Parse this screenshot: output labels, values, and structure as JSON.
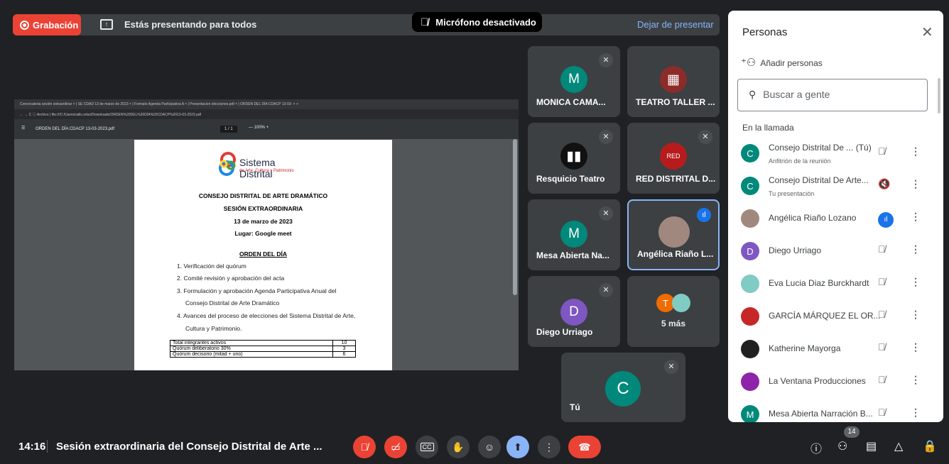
{
  "top": {
    "recording_label": "Grabación",
    "presenting_text": "Estás presentando para todos",
    "stop_presenting": "Dejar de presentar",
    "mic_toast": "Micrófono desactivado"
  },
  "shared_doc": {
    "tabs_text": "Convocatoria sesión extraordinar ×  |  SE CDAD 13 de marzo de 2023 ×  |  Formato Agenda Participativa A ×  |  Presentacion elecciones.pdf ×  |  ORDEN DEL DÍA CDACP 13-03- ×  +",
    "url_text": "←  →  C   ⓘ Archivo | file:///C:/Users/raiib.celso/Downloads/ORDEN%20DEL%20DÍA%20CDACP%2013-03-2023.pdf",
    "pdf_title": "ORDEN DEL DÍA CDACP 13-03-2023.pdf",
    "pdf_pages": "1 / 1",
    "pdf_zoom": "—  100%  +",
    "logo_line1": "Sistema Distrital",
    "logo_line2": "de Arte, Cultura y Patrimonio",
    "heading1": "CONSEJO DISTRITAL DE ARTE DRAMÁTICO",
    "heading2": "SESIÓN EXTRAORDINARIA",
    "heading3": "13 de marzo de 2023",
    "heading4": "Lugar: Google meet",
    "agenda_title": "ORDEN DEL DÍA",
    "items": [
      "1.  Verificación del quórum",
      "2.  Comité revisión y aprobación del acta",
      "3.  Formulación y aprobación Agenda Participativa Anual del",
      "Consejo Distrital de Arte Dramático",
      "4.  Avances del proceso de elecciones del Sistema Distrital de Arte,",
      "Cultura y Patrimonio."
    ],
    "table": [
      [
        "Total integrantes activos",
        "10"
      ],
      [
        "Quórum deliberatorio 30%",
        "3"
      ],
      [
        "Quórum decisorio (mitad + uno)",
        "6"
      ]
    ]
  },
  "tiles": [
    {
      "name": "MONICA CAMA...",
      "initial": "M",
      "color": "#00897b"
    },
    {
      "name": "TEATRO TALLER ...",
      "initial": "",
      "color": "#8d2b2b"
    },
    {
      "name": "Resquicio Teatro",
      "initial": "",
      "color": "#111111"
    },
    {
      "name": "RED DISTRITAL D...",
      "initial": "",
      "color": "#b71c1c"
    },
    {
      "name": "Mesa Abierta Na...",
      "initial": "M",
      "color": "#00897b"
    },
    {
      "name": "Angélica Riaño L...",
      "initial": "",
      "color": "#a1887f"
    },
    {
      "name": "Diego Urriago",
      "initial": "D",
      "color": "#7e57c2"
    },
    {
      "name": "5 más",
      "initial": "T",
      "color": "#ef6c00"
    },
    {
      "name": "Tú",
      "initial": "C",
      "color": "#00897b"
    }
  ],
  "people": {
    "title": "Personas",
    "add": "Añadir personas",
    "search_placeholder": "Buscar a gente",
    "section": "En la llamada",
    "rows": [
      {
        "name": "Consejo Distrital De ...  (Tú)",
        "sub": "Anfitrión de la reunión",
        "initial": "C",
        "color": "#00897b"
      },
      {
        "name": "Consejo Distrital De Arte...",
        "sub": "Tu presentación",
        "initial": "C",
        "color": "#00897b"
      },
      {
        "name": "Angélica Riaño Lozano",
        "sub": "",
        "initial": "",
        "color": "#a1887f"
      },
      {
        "name": "Diego Urriago",
        "sub": "",
        "initial": "D",
        "color": "#7e57c2"
      },
      {
        "name": "Eva Lucia Diaz Burckhardt",
        "sub": "",
        "initial": "",
        "color": "#80cbc4"
      },
      {
        "name": "GARCÍA MÁRQUEZ EL OR...",
        "sub": "",
        "initial": "",
        "color": "#c62828"
      },
      {
        "name": "Katherine Mayorga",
        "sub": "",
        "initial": "",
        "color": "#212121"
      },
      {
        "name": "La Ventana Producciones",
        "sub": "",
        "initial": "",
        "color": "#8e24aa"
      },
      {
        "name": "Mesa Abierta Narración B...",
        "sub": "",
        "initial": "M",
        "color": "#00897b"
      }
    ]
  },
  "bottom": {
    "time": "14:16",
    "title": "Sesión extraordinaria del Consejo Distrital de Arte ...",
    "participant_count": "14"
  }
}
